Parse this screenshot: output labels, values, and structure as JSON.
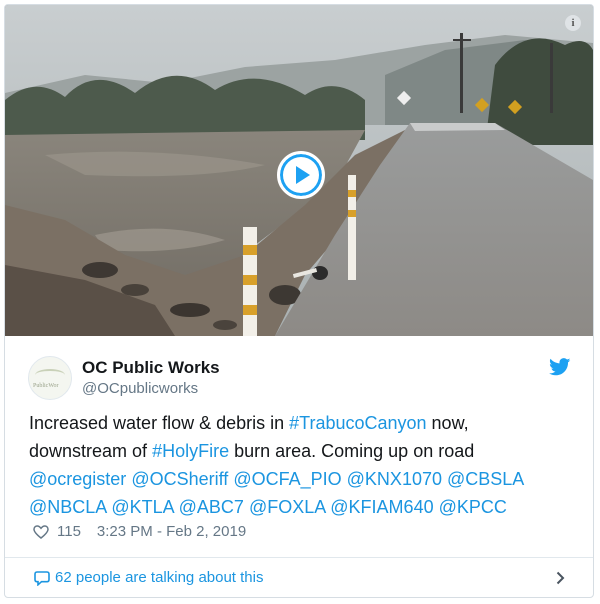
{
  "tweet": {
    "author": {
      "name": "OC Public Works",
      "handle": "@OCpublicworks",
      "avatar_text": "PublicWor"
    },
    "text_lines": [
      [
        {
          "text": "Increased water flow & debris in ",
          "link": false
        },
        {
          "text": "#TrabucoCanyon",
          "link": true
        },
        {
          "text": " now,",
          "link": false
        }
      ],
      [
        {
          "text": "downstream of ",
          "link": false
        },
        {
          "text": "#HolyFire",
          "link": true
        },
        {
          "text": " burn area. Coming up on road",
          "link": false
        }
      ],
      [
        {
          "text": "@ocregister",
          "link": true
        },
        {
          "text": " ",
          "link": false
        },
        {
          "text": "@OCSheriff",
          "link": true
        },
        {
          "text": " ",
          "link": false
        },
        {
          "text": "@OCFA_PIO",
          "link": true
        },
        {
          "text": " ",
          "link": false
        },
        {
          "text": "@KNX1070",
          "link": true
        },
        {
          "text": " ",
          "link": false
        },
        {
          "text": "@CBSLA",
          "link": true
        }
      ],
      [
        {
          "text": "@NBCLA",
          "link": true
        },
        {
          "text": " ",
          "link": false
        },
        {
          "text": "@KTLA",
          "link": true
        },
        {
          "text": " ",
          "link": false
        },
        {
          "text": "@ABC7",
          "link": true
        },
        {
          "text": " ",
          "link": false
        },
        {
          "text": "@FOXLA",
          "link": true
        },
        {
          "text": " ",
          "link": false
        },
        {
          "text": "@KFIAM640",
          "link": true
        },
        {
          "text": " ",
          "link": false
        },
        {
          "text": "@KPCC",
          "link": true
        }
      ]
    ],
    "likes": "115",
    "timestamp": "3:23 PM - Feb 2, 2019",
    "conversation": "62 people are talking about this"
  },
  "icons": {
    "info": "info-icon",
    "play": "play-icon",
    "bird": "twitter-bird-icon",
    "heart": "heart-icon",
    "bubble": "speech-bubble-icon",
    "chevron": "chevron-right-icon"
  },
  "colors": {
    "link": "#1b95e0",
    "brand": "#1da1f2",
    "text": "#14171a",
    "muted": "#657786"
  }
}
